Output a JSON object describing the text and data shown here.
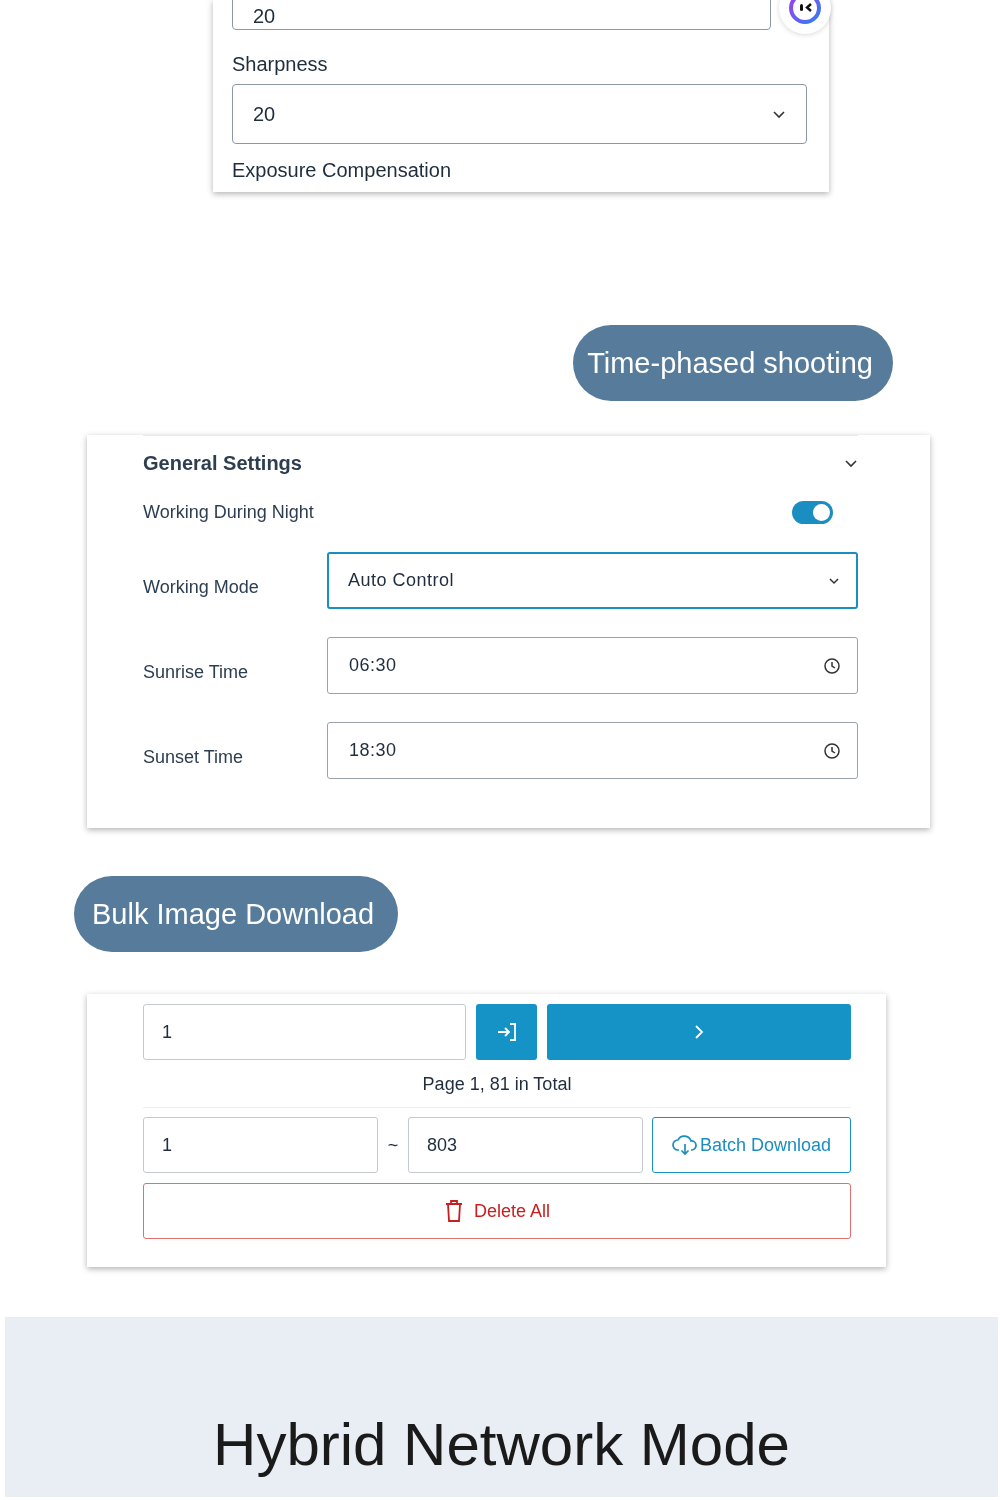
{
  "camera_panel": {
    "fields": [
      {
        "kind": "input",
        "value": "20"
      },
      {
        "kind": "select",
        "label": "Sharpness",
        "value": "20"
      }
    ],
    "next_label": "Exposure Compensation"
  },
  "time_section": {
    "title": "Time-phased shooting"
  },
  "general_settings": {
    "title": "General Settings",
    "expanded": true,
    "night": {
      "label": "Working During Night",
      "on": true
    },
    "rows": [
      {
        "kind": "select",
        "label": "Working Mode",
        "value": "Auto Control",
        "focused": true
      },
      {
        "kind": "time",
        "label": "Sunrise Time",
        "value": "06:30",
        "focused": false
      },
      {
        "kind": "time",
        "label": "Sunset Time",
        "value": "18:30",
        "focused": false
      }
    ]
  },
  "bulk_section": {
    "title": "Bulk Image Download"
  },
  "download": {
    "page_value": "1",
    "page_info": "Page 1, 81 in Total",
    "range_from": "1",
    "range_sep": "~",
    "range_to": "803",
    "batch_label": "Batch Download",
    "delete_label": "Delete All"
  },
  "banner": {
    "title": "Hybrid Network Mode"
  }
}
